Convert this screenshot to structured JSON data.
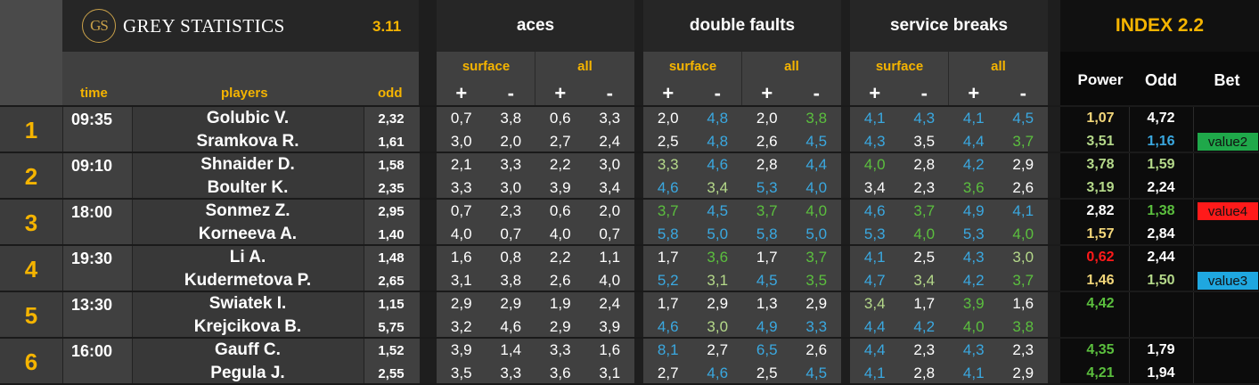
{
  "brand": {
    "logo_letters": "GS",
    "name": "GREY STATISTICS",
    "version": "3.11"
  },
  "index_title": "INDEX 2.2",
  "group_headers": [
    "aces",
    "double faults",
    "service breaks"
  ],
  "sub_headers": {
    "surface": "surface",
    "all": "all",
    "plus": "+",
    "minus": "-"
  },
  "column_headers": {
    "time": "time",
    "players": "players",
    "odd": "odd",
    "power": "Power",
    "odd2": "Odd",
    "bet": "Bet"
  },
  "colors": {
    "white": "#ffffff",
    "blue": "#3aa8e0",
    "green": "#5bbf3e",
    "lightgreen": "#b5d98a",
    "yellow": "#f3d77a",
    "red": "#ff1a1a",
    "gold": "#f5b400"
  },
  "matches": [
    {
      "num": "1",
      "time": "09:35",
      "p1": {
        "name": "Golubic V.",
        "odd": "2,32",
        "stats": [
          [
            "0,7",
            "white"
          ],
          [
            "3,8",
            "white"
          ],
          [
            "0,6",
            "white"
          ],
          [
            "3,3",
            "white"
          ],
          [
            "2,0",
            "white"
          ],
          [
            "4,8",
            "blue"
          ],
          [
            "2,0",
            "white"
          ],
          [
            "3,8",
            "green"
          ],
          [
            "4,1",
            "blue"
          ],
          [
            "4,3",
            "blue"
          ],
          [
            "4,1",
            "blue"
          ],
          [
            "4,5",
            "blue"
          ]
        ],
        "power": [
          "1,07",
          "yellow"
        ],
        "odd2": [
          "4,72",
          "white"
        ],
        "bet": null
      },
      "p2": {
        "name": "Sramkova R.",
        "odd": "1,61",
        "stats": [
          [
            "3,0",
            "white"
          ],
          [
            "2,0",
            "white"
          ],
          [
            "2,7",
            "white"
          ],
          [
            "2,4",
            "white"
          ],
          [
            "2,5",
            "white"
          ],
          [
            "4,8",
            "blue"
          ],
          [
            "2,6",
            "white"
          ],
          [
            "4,5",
            "blue"
          ],
          [
            "4,3",
            "blue"
          ],
          [
            "3,5",
            "white"
          ],
          [
            "4,4",
            "blue"
          ],
          [
            "3,7",
            "green"
          ]
        ],
        "power": [
          "3,51",
          "lightgreen"
        ],
        "odd2": [
          "1,16",
          "blue"
        ],
        "bet": [
          "value2",
          "#1fa84a"
        ]
      }
    },
    {
      "num": "2",
      "time": "09:10",
      "p1": {
        "name": "Shnaider D.",
        "odd": "1,58",
        "stats": [
          [
            "2,1",
            "white"
          ],
          [
            "3,3",
            "white"
          ],
          [
            "2,2",
            "white"
          ],
          [
            "3,0",
            "white"
          ],
          [
            "3,3",
            "lightgreen"
          ],
          [
            "4,6",
            "blue"
          ],
          [
            "2,8",
            "white"
          ],
          [
            "4,4",
            "blue"
          ],
          [
            "4,0",
            "green"
          ],
          [
            "2,8",
            "white"
          ],
          [
            "4,2",
            "blue"
          ],
          [
            "2,9",
            "white"
          ]
        ],
        "power": [
          "3,78",
          "lightgreen"
        ],
        "odd2": [
          "1,59",
          "lightgreen"
        ],
        "bet": null
      },
      "p2": {
        "name": "Boulter K.",
        "odd": "2,35",
        "stats": [
          [
            "3,3",
            "white"
          ],
          [
            "3,0",
            "white"
          ],
          [
            "3,9",
            "white"
          ],
          [
            "3,4",
            "white"
          ],
          [
            "4,6",
            "blue"
          ],
          [
            "3,4",
            "lightgreen"
          ],
          [
            "5,3",
            "blue"
          ],
          [
            "4,0",
            "blue"
          ],
          [
            "3,4",
            "white"
          ],
          [
            "2,3",
            "white"
          ],
          [
            "3,6",
            "green"
          ],
          [
            "2,6",
            "white"
          ]
        ],
        "power": [
          "3,19",
          "lightgreen"
        ],
        "odd2": [
          "2,24",
          "white"
        ],
        "bet": null
      }
    },
    {
      "num": "3",
      "time": "18:00",
      "p1": {
        "name": "Sonmez Z.",
        "odd": "2,95",
        "stats": [
          [
            "0,7",
            "white"
          ],
          [
            "2,3",
            "white"
          ],
          [
            "0,6",
            "white"
          ],
          [
            "2,0",
            "white"
          ],
          [
            "3,7",
            "green"
          ],
          [
            "4,5",
            "blue"
          ],
          [
            "3,7",
            "green"
          ],
          [
            "4,0",
            "green"
          ],
          [
            "4,6",
            "blue"
          ],
          [
            "3,7",
            "green"
          ],
          [
            "4,9",
            "blue"
          ],
          [
            "4,1",
            "blue"
          ]
        ],
        "power": [
          "2,82",
          "white"
        ],
        "odd2": [
          "1,38",
          "green"
        ],
        "bet": [
          "value4",
          "#ff1a1a"
        ]
      },
      "p2": {
        "name": "Korneeva A.",
        "odd": "1,40",
        "stats": [
          [
            "4,0",
            "white"
          ],
          [
            "0,7",
            "white"
          ],
          [
            "4,0",
            "white"
          ],
          [
            "0,7",
            "white"
          ],
          [
            "5,8",
            "blue"
          ],
          [
            "5,0",
            "blue"
          ],
          [
            "5,8",
            "blue"
          ],
          [
            "5,0",
            "blue"
          ],
          [
            "5,3",
            "blue"
          ],
          [
            "4,0",
            "green"
          ],
          [
            "5,3",
            "blue"
          ],
          [
            "4,0",
            "green"
          ]
        ],
        "power": [
          "1,57",
          "yellow"
        ],
        "odd2": [
          "2,84",
          "white"
        ],
        "bet": null
      }
    },
    {
      "num": "4",
      "time": "19:30",
      "p1": {
        "name": "Li A.",
        "odd": "1,48",
        "stats": [
          [
            "1,6",
            "white"
          ],
          [
            "0,8",
            "white"
          ],
          [
            "2,2",
            "white"
          ],
          [
            "1,1",
            "white"
          ],
          [
            "1,7",
            "white"
          ],
          [
            "3,6",
            "green"
          ],
          [
            "1,7",
            "white"
          ],
          [
            "3,7",
            "green"
          ],
          [
            "4,1",
            "blue"
          ],
          [
            "2,5",
            "white"
          ],
          [
            "4,3",
            "blue"
          ],
          [
            "3,0",
            "lightgreen"
          ]
        ],
        "power": [
          "0,62",
          "red"
        ],
        "odd2": [
          "2,44",
          "white"
        ],
        "bet": null
      },
      "p2": {
        "name": "Kudermetova P.",
        "odd": "2,65",
        "stats": [
          [
            "3,1",
            "white"
          ],
          [
            "3,8",
            "white"
          ],
          [
            "2,6",
            "white"
          ],
          [
            "4,0",
            "white"
          ],
          [
            "5,2",
            "blue"
          ],
          [
            "3,1",
            "lightgreen"
          ],
          [
            "4,5",
            "blue"
          ],
          [
            "3,5",
            "green"
          ],
          [
            "4,7",
            "blue"
          ],
          [
            "3,4",
            "lightgreen"
          ],
          [
            "4,2",
            "blue"
          ],
          [
            "3,7",
            "green"
          ]
        ],
        "power": [
          "1,46",
          "yellow"
        ],
        "odd2": [
          "1,50",
          "lightgreen"
        ],
        "bet": [
          "value3",
          "#1fa7e0"
        ]
      }
    },
    {
      "num": "5",
      "time": "13:30",
      "p1": {
        "name": "Swiatek I.",
        "odd": "1,15",
        "stats": [
          [
            "2,9",
            "white"
          ],
          [
            "2,9",
            "white"
          ],
          [
            "1,9",
            "white"
          ],
          [
            "2,4",
            "white"
          ],
          [
            "1,7",
            "white"
          ],
          [
            "2,9",
            "white"
          ],
          [
            "1,3",
            "white"
          ],
          [
            "2,9",
            "white"
          ],
          [
            "3,4",
            "lightgreen"
          ],
          [
            "1,7",
            "white"
          ],
          [
            "3,9",
            "green"
          ],
          [
            "1,6",
            "white"
          ]
        ],
        "power": [
          "4,42",
          "green"
        ],
        "odd2": null,
        "bet": null
      },
      "p2": {
        "name": "Krejcikova B.",
        "odd": "5,75",
        "stats": [
          [
            "3,2",
            "white"
          ],
          [
            "4,6",
            "white"
          ],
          [
            "2,9",
            "white"
          ],
          [
            "3,9",
            "white"
          ],
          [
            "4,6",
            "blue"
          ],
          [
            "3,0",
            "lightgreen"
          ],
          [
            "4,9",
            "blue"
          ],
          [
            "3,3",
            "blue"
          ],
          [
            "4,4",
            "blue"
          ],
          [
            "4,2",
            "blue"
          ],
          [
            "4,0",
            "green"
          ],
          [
            "3,8",
            "green"
          ]
        ],
        "power": null,
        "odd2": null,
        "bet": null
      }
    },
    {
      "num": "6",
      "time": "16:00",
      "p1": {
        "name": "Gauff C.",
        "odd": "1,52",
        "stats": [
          [
            "3,9",
            "white"
          ],
          [
            "1,4",
            "white"
          ],
          [
            "3,3",
            "white"
          ],
          [
            "1,6",
            "white"
          ],
          [
            "8,1",
            "blue"
          ],
          [
            "2,7",
            "white"
          ],
          [
            "6,5",
            "blue"
          ],
          [
            "2,6",
            "white"
          ],
          [
            "4,4",
            "blue"
          ],
          [
            "2,3",
            "white"
          ],
          [
            "4,3",
            "blue"
          ],
          [
            "2,3",
            "white"
          ]
        ],
        "power": [
          "4,35",
          "green"
        ],
        "odd2": [
          "1,79",
          "white"
        ],
        "bet": null
      },
      "p2": {
        "name": "Pegula J.",
        "odd": "2,55",
        "stats": [
          [
            "3,5",
            "white"
          ],
          [
            "3,3",
            "white"
          ],
          [
            "3,6",
            "white"
          ],
          [
            "3,1",
            "white"
          ],
          [
            "2,7",
            "white"
          ],
          [
            "4,6",
            "blue"
          ],
          [
            "2,5",
            "white"
          ],
          [
            "4,5",
            "blue"
          ],
          [
            "4,1",
            "blue"
          ],
          [
            "2,8",
            "white"
          ],
          [
            "4,1",
            "blue"
          ],
          [
            "2,9",
            "white"
          ]
        ],
        "power": [
          "4,21",
          "green"
        ],
        "odd2": [
          "1,94",
          "white"
        ],
        "bet": null
      }
    }
  ]
}
